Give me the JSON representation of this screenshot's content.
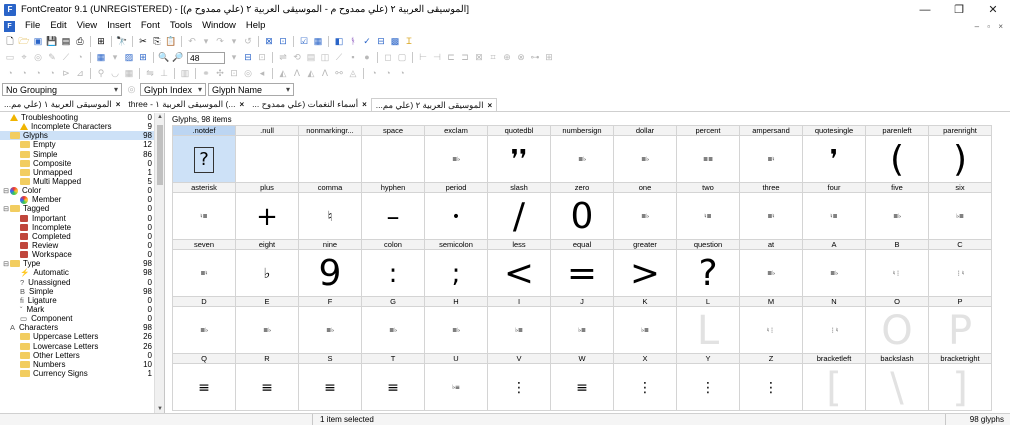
{
  "window": {
    "title": "FontCreator 9.1 (UNREGISTERED) - [الموسيقى العربية ٢ (علي ممدوح م - الموسيقى العربية ٢ (علي ممدوح م)]",
    "app_icon": "F",
    "minimize": "—",
    "maximize": "❐",
    "close": "✕"
  },
  "menu": {
    "items": [
      "File",
      "Edit",
      "View",
      "Insert",
      "Font",
      "Tools",
      "Window",
      "Help"
    ],
    "mdi_controls": "– ▫ ×"
  },
  "toolbar": {
    "zoom_value": "48"
  },
  "groupbar": {
    "grouping": "No Grouping",
    "index": "Glyph Index",
    "name": "Glyph Name"
  },
  "tabs": [
    {
      "label": "...الموسيقى العربية ١ (علي مم",
      "active": false
    },
    {
      "label": "three - الموسيقى العربية ١ (...",
      "active": false
    },
    {
      "label": "... أسماء النغمات (علي ممدوح",
      "active": false
    },
    {
      "label": "...الموسيقى العربية ٢ (علي مم",
      "active": true
    }
  ],
  "tab_close": "×",
  "sidebar": {
    "items": [
      {
        "label": "Troubleshooting",
        "count": "0",
        "indent": 0,
        "toggle": "",
        "icon": "warn"
      },
      {
        "label": "Incomplete Characters",
        "count": "9",
        "indent": 1,
        "toggle": "",
        "icon": "warn"
      },
      {
        "label": "Glyphs",
        "count": "98",
        "indent": 0,
        "toggle": "",
        "icon": "folder",
        "selected": true
      },
      {
        "label": "Empty",
        "count": "12",
        "indent": 1,
        "toggle": "",
        "icon": "folder"
      },
      {
        "label": "Simple",
        "count": "86",
        "indent": 1,
        "toggle": "",
        "icon": "folder"
      },
      {
        "label": "Composite",
        "count": "0",
        "indent": 1,
        "toggle": "",
        "icon": "folder"
      },
      {
        "label": "Unmapped",
        "count": "1",
        "indent": 1,
        "toggle": "",
        "icon": "folder"
      },
      {
        "label": "Multi Mapped",
        "count": "5",
        "indent": 1,
        "toggle": "",
        "icon": "folder"
      },
      {
        "label": "Color",
        "count": "0",
        "indent": 0,
        "toggle": "⊟",
        "icon": "color"
      },
      {
        "label": "Member",
        "count": "0",
        "indent": 1,
        "toggle": "",
        "icon": "color"
      },
      {
        "label": "Tagged",
        "count": "0",
        "indent": 0,
        "toggle": "⊟",
        "icon": "folder"
      },
      {
        "label": "Important",
        "count": "0",
        "indent": 1,
        "toggle": "",
        "icon": "flag"
      },
      {
        "label": "Incomplete",
        "count": "0",
        "indent": 1,
        "toggle": "",
        "icon": "flag"
      },
      {
        "label": "Completed",
        "count": "0",
        "indent": 1,
        "toggle": "",
        "icon": "flag"
      },
      {
        "label": "Review",
        "count": "0",
        "indent": 1,
        "toggle": "",
        "icon": "flag"
      },
      {
        "label": "Workspace",
        "count": "0",
        "indent": 1,
        "toggle": "",
        "icon": "flag"
      },
      {
        "label": "Type",
        "count": "98",
        "indent": 0,
        "toggle": "⊟",
        "icon": "folder"
      },
      {
        "label": "Automatic",
        "count": "98",
        "indent": 1,
        "toggle": "",
        "icon": "sym",
        "sym": "⚡"
      },
      {
        "label": "Unassigned",
        "count": "0",
        "indent": 1,
        "toggle": "",
        "icon": "sym",
        "sym": "?"
      },
      {
        "label": "Simple",
        "count": "98",
        "indent": 1,
        "toggle": "",
        "icon": "sym",
        "sym": "B"
      },
      {
        "label": "Ligature",
        "count": "0",
        "indent": 1,
        "toggle": "",
        "icon": "sym",
        "sym": "fi"
      },
      {
        "label": "Mark",
        "count": "0",
        "indent": 1,
        "toggle": "",
        "icon": "sym",
        "sym": "˘"
      },
      {
        "label": "Component",
        "count": "0",
        "indent": 1,
        "toggle": "",
        "icon": "sym",
        "sym": "▭"
      },
      {
        "label": "Characters",
        "count": "98",
        "indent": 0,
        "toggle": "",
        "icon": "sym",
        "sym": "A"
      },
      {
        "label": "Uppercase Letters",
        "count": "26",
        "indent": 1,
        "toggle": "",
        "icon": "folder"
      },
      {
        "label": "Lowercase Letters",
        "count": "26",
        "indent": 1,
        "toggle": "",
        "icon": "folder"
      },
      {
        "label": "Other Letters",
        "count": "0",
        "indent": 1,
        "toggle": "",
        "icon": "folder"
      },
      {
        "label": "Numbers",
        "count": "10",
        "indent": 1,
        "toggle": "",
        "icon": "folder"
      },
      {
        "label": "Currency Signs",
        "count": "1",
        "indent": 1,
        "toggle": "",
        "icon": "folder"
      }
    ]
  },
  "main": {
    "items_count": "Glyphs, 98 items",
    "rows": [
      [
        {
          "name": ".notdef",
          "glyph": "?",
          "style": "notdef",
          "selected": true
        },
        {
          "name": ".null",
          "glyph": "",
          "style": "sm"
        },
        {
          "name": "nonmarkingr...",
          "glyph": "",
          "style": "sm"
        },
        {
          "name": "space",
          "glyph": "",
          "style": "sm"
        },
        {
          "name": "exclam",
          "glyph": "≣♭",
          "style": "stack"
        },
        {
          "name": "quotedbl",
          "glyph": "❜❜",
          "style": "md"
        },
        {
          "name": "numbersign",
          "glyph": "≣♭",
          "style": "stack"
        },
        {
          "name": "dollar",
          "glyph": "≣♭",
          "style": "stack"
        },
        {
          "name": "percent",
          "glyph": "≣≣",
          "style": "stack"
        },
        {
          "name": "ampersand",
          "glyph": "≣♮",
          "style": "stack"
        },
        {
          "name": "quotesingle",
          "glyph": "❜",
          "style": "md"
        },
        {
          "name": "parenleft",
          "glyph": "(",
          "style": "lg"
        },
        {
          "name": "parenright",
          "glyph": ")",
          "style": "lg"
        }
      ],
      [
        {
          "name": "asterisk",
          "glyph": "♮≣",
          "style": "stack"
        },
        {
          "name": "plus",
          "glyph": "+",
          "style": "md"
        },
        {
          "name": "comma",
          "glyph": "♮",
          "style": "sm"
        },
        {
          "name": "hyphen",
          "glyph": "–",
          "style": "md"
        },
        {
          "name": "period",
          "glyph": "•",
          "style": "sm"
        },
        {
          "name": "slash",
          "glyph": "/",
          "style": "lg"
        },
        {
          "name": "zero",
          "glyph": "0",
          "style": "lg"
        },
        {
          "name": "one",
          "glyph": "≣♭",
          "style": "stack"
        },
        {
          "name": "two",
          "glyph": "♮≣",
          "style": "stack"
        },
        {
          "name": "three",
          "glyph": "≣♮",
          "style": "stack"
        },
        {
          "name": "four",
          "glyph": "♮≣",
          "style": "stack"
        },
        {
          "name": "five",
          "glyph": "≣♭",
          "style": "stack"
        },
        {
          "name": "six",
          "glyph": "♭≣",
          "style": "stack"
        }
      ],
      [
        {
          "name": "seven",
          "glyph": "≣♮",
          "style": "stack"
        },
        {
          "name": "eight",
          "glyph": "♭",
          "style": "sm"
        },
        {
          "name": "nine",
          "glyph": "9",
          "style": "lg"
        },
        {
          "name": "colon",
          "glyph": ":",
          "style": "md"
        },
        {
          "name": "semicolon",
          "glyph": ";",
          "style": "md"
        },
        {
          "name": "less",
          "glyph": "<",
          "style": "lg"
        },
        {
          "name": "equal",
          "glyph": "=",
          "style": "lg"
        },
        {
          "name": "greater",
          "glyph": ">",
          "style": "lg"
        },
        {
          "name": "question",
          "glyph": "?",
          "style": "lg"
        },
        {
          "name": "at",
          "glyph": "≣♭",
          "style": "stack"
        },
        {
          "name": "A",
          "glyph": "≣♭",
          "style": "stack"
        },
        {
          "name": "B",
          "glyph": "♮⋮",
          "style": "stack"
        },
        {
          "name": "C",
          "glyph": "⋮♮",
          "style": "stack"
        }
      ],
      [
        {
          "name": "D",
          "glyph": "≣♭",
          "style": "stack"
        },
        {
          "name": "E",
          "glyph": "≣♭",
          "style": "stack"
        },
        {
          "name": "F",
          "glyph": "≣♭",
          "style": "stack"
        },
        {
          "name": "G",
          "glyph": "≣♭",
          "style": "stack"
        },
        {
          "name": "H",
          "glyph": "≣♭",
          "style": "stack"
        },
        {
          "name": "I",
          "glyph": "♭≣",
          "style": "stack"
        },
        {
          "name": "J",
          "glyph": "♭≣",
          "style": "stack"
        },
        {
          "name": "K",
          "glyph": "♭≣",
          "style": "stack"
        },
        {
          "name": "L",
          "glyph": "L",
          "style": "ghost"
        },
        {
          "name": "M",
          "glyph": "♮⋮",
          "style": "stack"
        },
        {
          "name": "N",
          "glyph": "⋮♮",
          "style": "stack"
        },
        {
          "name": "O",
          "glyph": "O",
          "style": "ghost"
        },
        {
          "name": "P",
          "glyph": "P",
          "style": "ghost"
        }
      ],
      [
        {
          "name": "Q",
          "glyph": "≡",
          "style": "sm"
        },
        {
          "name": "R",
          "glyph": "≡",
          "style": "sm"
        },
        {
          "name": "S",
          "glyph": "≡",
          "style": "sm"
        },
        {
          "name": "T",
          "glyph": "≡",
          "style": "sm"
        },
        {
          "name": "U",
          "glyph": "♭≡",
          "style": "stack"
        },
        {
          "name": "V",
          "glyph": "⋮",
          "style": "sm"
        },
        {
          "name": "W",
          "glyph": "≡",
          "style": "sm"
        },
        {
          "name": "X",
          "glyph": "⋮",
          "style": "sm"
        },
        {
          "name": "Y",
          "glyph": "⋮",
          "style": "sm"
        },
        {
          "name": "Z",
          "glyph": "⋮",
          "style": "sm"
        },
        {
          "name": "bracketleft",
          "glyph": "[",
          "style": "ghost"
        },
        {
          "name": "backslash",
          "glyph": "\\",
          "style": "ghost"
        },
        {
          "name": "bracketright",
          "glyph": "]",
          "style": "ghost"
        }
      ]
    ]
  },
  "status": {
    "selection": "1 item selected",
    "glyph_count": "98 glyphs"
  },
  "colors": {
    "selection": "#cde1f7",
    "folder": "#f2cd60",
    "accent": "#2a64c8"
  }
}
